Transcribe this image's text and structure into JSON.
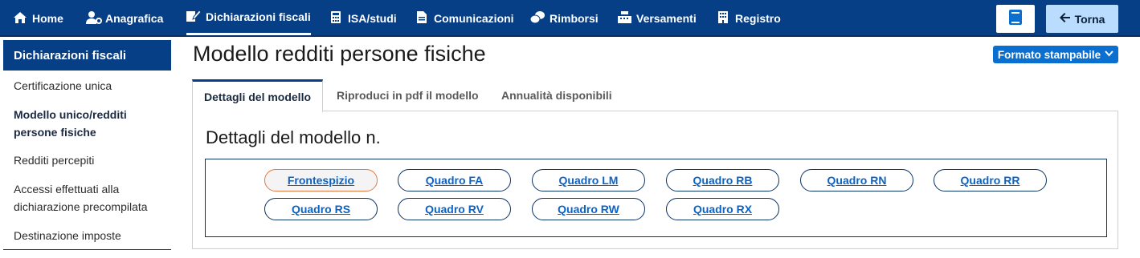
{
  "nav": {
    "items": [
      {
        "label": "Home",
        "icon": "home-icon",
        "glyph": "⌂"
      },
      {
        "label": "Anagrafica",
        "icon": "user-gear-icon",
        "glyph": "👤"
      },
      {
        "label": "Dichiarazioni fiscali",
        "icon": "edit-document-icon",
        "glyph": "✎",
        "active": true
      },
      {
        "label": "ISA/studi",
        "icon": "calculator-icon",
        "glyph": "▦"
      },
      {
        "label": "Comunicazioni",
        "icon": "document-icon",
        "glyph": "▤"
      },
      {
        "label": "Rimborsi",
        "icon": "coins-icon",
        "glyph": "●"
      },
      {
        "label": "Versamenti",
        "icon": "cash-register-icon",
        "glyph": "▣"
      },
      {
        "label": "Registro",
        "icon": "building-icon",
        "glyph": "▥"
      }
    ],
    "book_icon": "book-icon",
    "back_label": "Torna",
    "back_icon": "arrow-left-icon"
  },
  "sidebar": {
    "title": "Dichiarazioni fiscali",
    "items": [
      {
        "label": "Certificazione unica"
      },
      {
        "label": "Modello unico/redditi persone fisiche",
        "active": true
      },
      {
        "label": "Redditi percepiti"
      },
      {
        "label": "Accessi effettuati alla dichiarazione precompilata"
      },
      {
        "label": "Destinazione imposte"
      }
    ]
  },
  "main": {
    "title": "Modello redditi persone fisiche",
    "format_button": "Formato stampabile",
    "tabs": [
      {
        "label": "Dettagli del modello",
        "active": true
      },
      {
        "label": "Riproduci in pdf il modello"
      },
      {
        "label": "Annualità disponibili"
      }
    ],
    "panel_title": "Dettagli del modello n.",
    "quadri": [
      {
        "label": "Frontespizio",
        "selected": true
      },
      {
        "label": "Quadro FA"
      },
      {
        "label": "Quadro LM"
      },
      {
        "label": "Quadro RB"
      },
      {
        "label": "Quadro RN"
      },
      {
        "label": "Quadro RR"
      },
      {
        "label": "Quadro RS"
      },
      {
        "label": "Quadro RV"
      },
      {
        "label": "Quadro RW"
      },
      {
        "label": "Quadro RX"
      }
    ]
  },
  "colors": {
    "nav_bg": "#073f87",
    "accent_blue": "#0b6fd0",
    "link_blue": "#0b63c6",
    "back_button_bg": "#b9dcff",
    "selected_border": "#e07a45"
  }
}
